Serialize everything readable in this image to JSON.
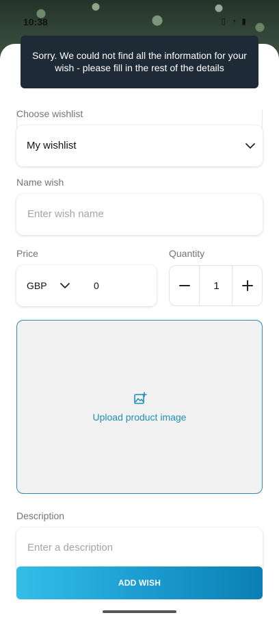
{
  "status_bar": {
    "time": "10:38"
  },
  "toast": {
    "message": "Sorry. We could not find all the information for your wish - please fill in the rest of the details"
  },
  "form": {
    "wishlist_label": "Choose wishlist",
    "wishlist_value": "My wishlist",
    "name_label": "Name wish",
    "name_placeholder": "Enter wish name",
    "price_label": "Price",
    "currency_value": "GBP",
    "price_value": "0",
    "quantity_label": "Quantity",
    "quantity_value": "1",
    "upload_label": "Upload product image",
    "description_label": "Description",
    "description_placeholder": "Enter a description",
    "submit_label": "ADD WISH"
  },
  "colors": {
    "accent": "#1d8fb6",
    "button_gradient_start": "#34bee7",
    "button_gradient_end": "#0b7fb3",
    "toast_bg": "#1f2a37"
  },
  "icons": {
    "wishlist_dropdown": "chevron-down-icon",
    "currency_dropdown": "chevron-down-icon",
    "decrement": "minus-icon",
    "increment": "plus-icon",
    "upload": "image-add-icon"
  }
}
